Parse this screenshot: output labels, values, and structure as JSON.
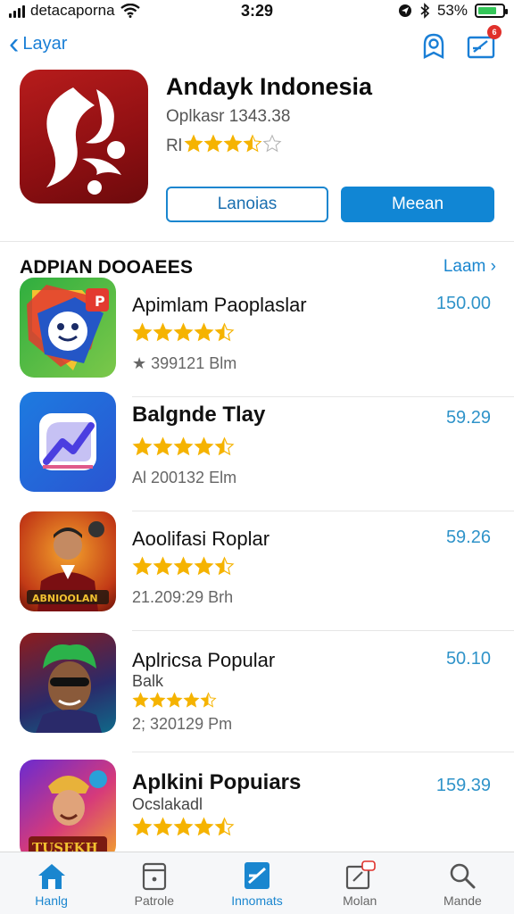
{
  "status_bar": {
    "carrier": "detacaporna",
    "time": "3:29",
    "battery": "53%",
    "battery_level": 0.75
  },
  "nav": {
    "back_label": "Layar",
    "profile_icon": "profile-icon",
    "inbox_icon": "inbox-icon",
    "badge": "6"
  },
  "featured": {
    "title": "Andayk Indonesia",
    "subtitle": "Oplkasr 1343.38",
    "rating_prefix": "Rl",
    "rating": 3.5,
    "button_secondary": "Lanoias",
    "button_primary": "Meean"
  },
  "section": {
    "title": "ADPIAN DOOAEES",
    "see_all": "Laam"
  },
  "apps": [
    {
      "name": "Apimlam Paoplaslar",
      "category": "",
      "rating": 4.5,
      "meta": "★ 399121 Blm",
      "price": "150.00"
    },
    {
      "name": "Balgnde Tlay",
      "category": "",
      "rating": 4.5,
      "meta": "Al 200132 Elm",
      "price": "59.29"
    },
    {
      "name": "Aoolifasi Roplar",
      "category": "",
      "rating": 4.5,
      "meta": "21.209:29 Brh",
      "price": "59.26"
    },
    {
      "name": "Aplricsa Popular",
      "category": "Balk",
      "rating": 4.5,
      "meta": "2; 320129 Pm",
      "price": "50.10"
    },
    {
      "name": "Aplkini Popuiars",
      "category": "Ocslakadl",
      "rating": 4.5,
      "meta": "",
      "price": "159.39"
    }
  ],
  "tabs": [
    {
      "label": "Hanlg",
      "active": true
    },
    {
      "label": "Patrole",
      "active": false
    },
    {
      "label": "Innomats",
      "active": false
    },
    {
      "label": "Molan",
      "active": false
    },
    {
      "label": "Mande",
      "active": false
    }
  ],
  "colors": {
    "accent": "#1a86cf",
    "star": "#f5b301",
    "price": "#2f93c9"
  }
}
